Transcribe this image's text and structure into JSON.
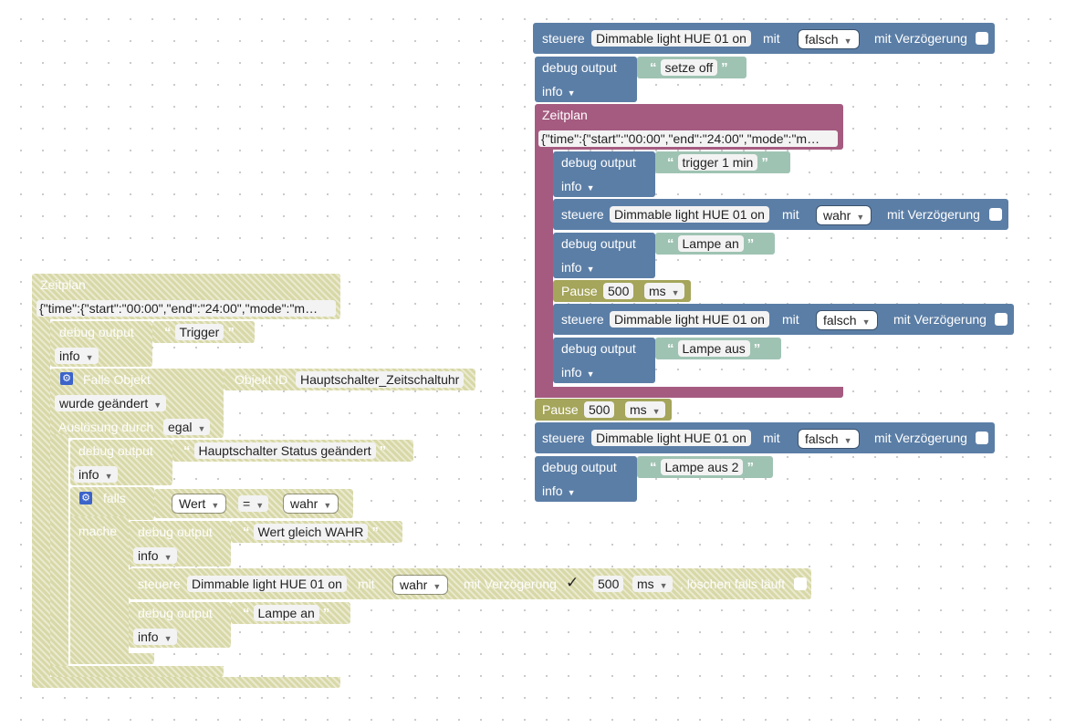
{
  "labels": {
    "control": "steuere",
    "with": "mit",
    "with_delay": "mit Verzögerung",
    "debug_output": "debug output",
    "schedule": "Zeitplan",
    "pause": "Pause",
    "if_object": "Falls Objekt",
    "object_id": "Objekt ID",
    "triggered_by": "Auslösung durch",
    "if": "falls",
    "do": "mache",
    "clear_if_running": ", löschen falls läuft"
  },
  "device": "Dimmable light HUE 01 on",
  "level": "info",
  "schedule_json": "{\"time\":{\"start\":\"00:00\",\"end\":\"24:00\",\"mode\":\"m…",
  "values": {
    "true": "wahr",
    "false": "falsch",
    "ms": "ms",
    "pause_ms": "500",
    "delay_ms": "500",
    "checkmark": "✓"
  },
  "strings": {
    "set_off": "setze off",
    "trigger_1min": "trigger 1 min",
    "lamp_on": "Lampe an",
    "lamp_off": "Lampe aus",
    "lamp_off_2": "Lampe aus 2",
    "trigger": "Trigger",
    "switch_status_changed": "Hauptschalter Status geändert",
    "value_equals_true": "Wert gleich WAHR"
  },
  "object": {
    "id": "Hauptschalter_Zeitschaltuhr",
    "changed": "wurde geändert",
    "any": "egal"
  },
  "compare": {
    "value": "Wert",
    "op": "="
  },
  "colors": {
    "device_block": "#5b7ea6",
    "schedule_block": "#a55b80",
    "pause_block": "#a5a55b",
    "disabled_block": "#d8d8a8"
  }
}
